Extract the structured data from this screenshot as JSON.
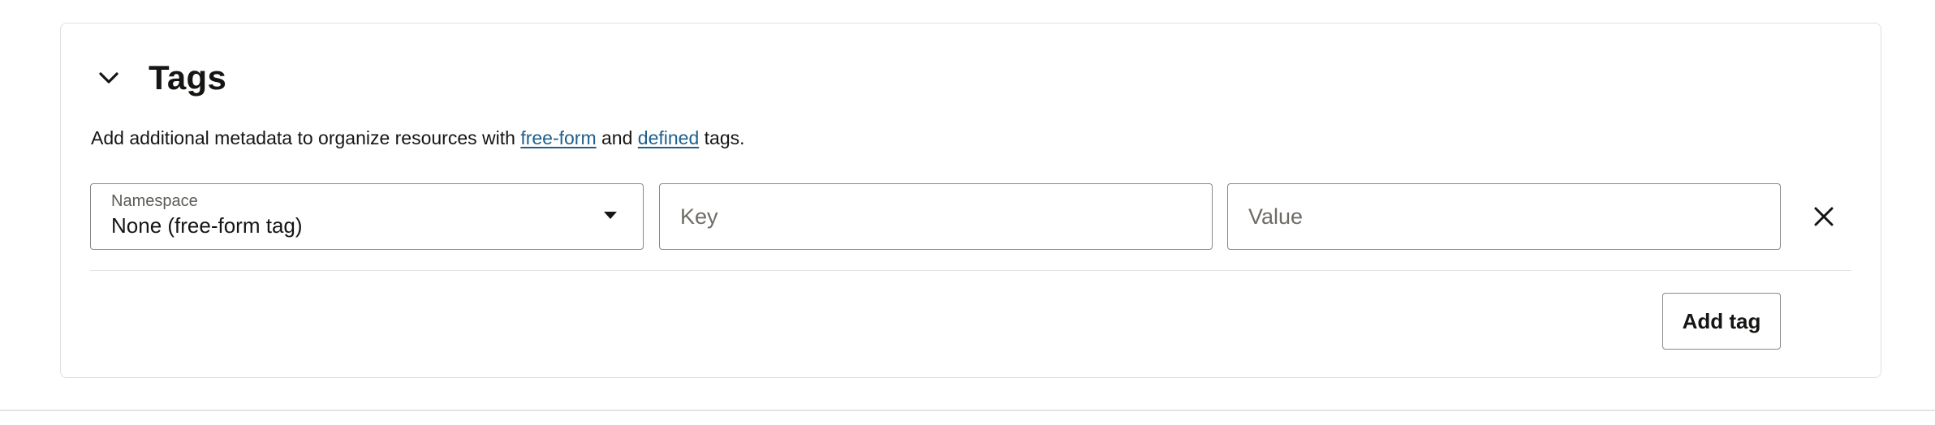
{
  "tags_section": {
    "title": "Tags",
    "description": {
      "prefix": "Add additional metadata to organize resources with ",
      "link_free_form": "free-form",
      "middle": " and ",
      "link_defined": "defined",
      "suffix": " tags."
    },
    "namespace": {
      "label": "Namespace",
      "value": "None (free-form tag)"
    },
    "key": {
      "value": "",
      "placeholder": "Key"
    },
    "value": {
      "value": "",
      "placeholder": "Value"
    },
    "add_tag_label": "Add tag"
  },
  "icons": {
    "collapse": "chevron-down-icon",
    "dropdown": "caret-down-icon",
    "remove": "close-icon"
  },
  "colors": {
    "link": "#1f5f8b",
    "text": "#161513",
    "border": "#8b8884"
  }
}
